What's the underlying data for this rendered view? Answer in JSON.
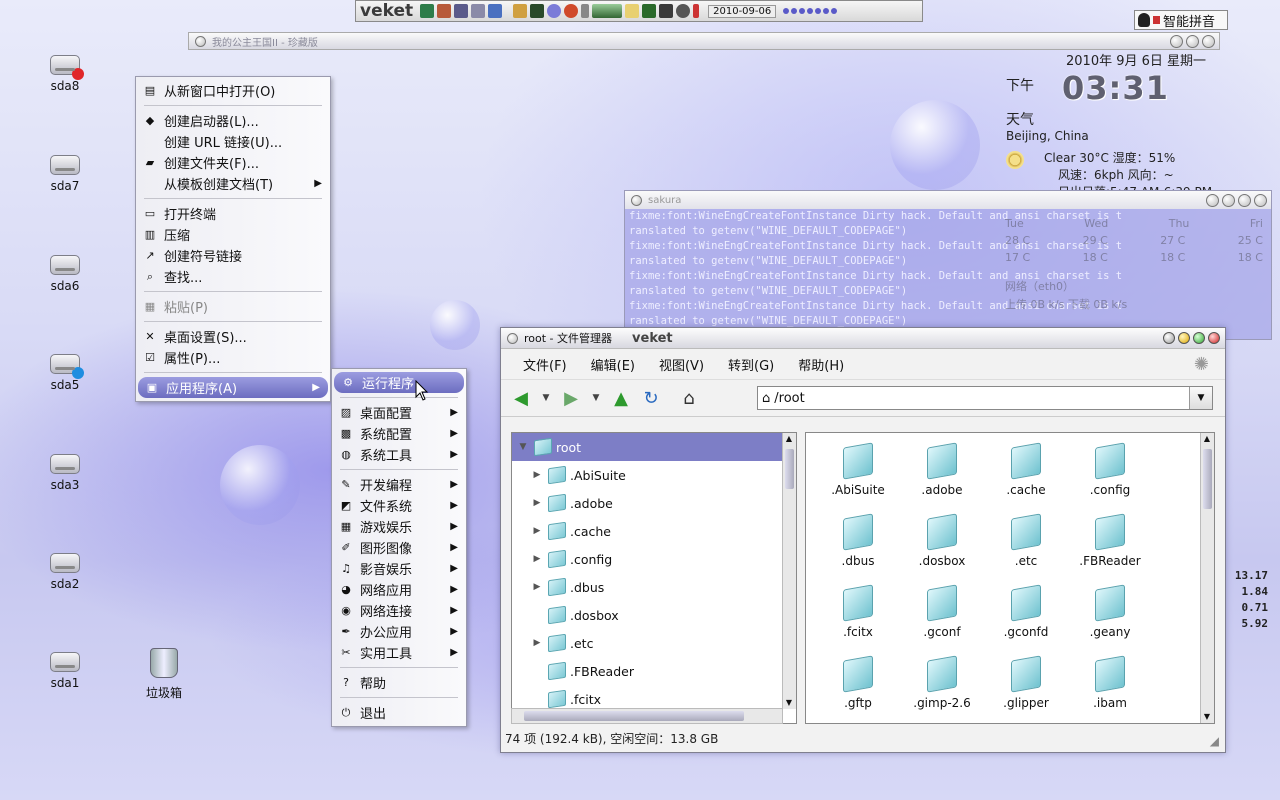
{
  "top_panel": {
    "logo": "veket",
    "date": "2010-09-06"
  },
  "ime": {
    "label": "智能拼音"
  },
  "bg_window": {
    "title": "我的公主王国II - 珍藏版"
  },
  "desktop_icons": [
    {
      "label": "sda8",
      "badge": "#e0262a"
    },
    {
      "label": "sda7",
      "badge": ""
    },
    {
      "label": "sda6",
      "badge": ""
    },
    {
      "label": "sda5",
      "badge": "#1e8de0"
    },
    {
      "label": "sda3",
      "badge": ""
    },
    {
      "label": "sda2",
      "badge": ""
    },
    {
      "label": "sda1",
      "badge": ""
    }
  ],
  "trash": {
    "label": "垃圾箱"
  },
  "widget": {
    "date": "2010年 9月 6日 星期一",
    "ampm": "下午",
    "time": "03:31",
    "weather_title": "天气",
    "location": "Beijing, China",
    "condition": "Clear  30°C 湿度：51%",
    "wind": "风速：6kph 风向：~",
    "sun": "日出日落:5:47 AM-6:39 PM",
    "forecast_days": [
      "Tue",
      "Wed",
      "Thu",
      "Fri"
    ],
    "forecast_highs": [
      "28 C",
      "29 C",
      "27 C",
      "25 C"
    ],
    "forecast_lows": [
      "17 C",
      "18 C",
      "18 C",
      "18 C"
    ],
    "net": "网络（eth0）",
    "net_rate": "上传 0B  k/s  下载 0B  k/s",
    "loads": [
      "13.17",
      "1.84",
      "0.71",
      "5.92"
    ]
  },
  "sakura": {
    "title": "sakura",
    "lines": [
      "fixme:font:WineEngCreateFontInstance Dirty hack. Default and ansi charset is t",
      "ranslated to getenv(\"WINE_DEFAULT_CODEPAGE\")",
      "fixme:font:WineEngCreateFontInstance Dirty hack. Default and ansi charset is t",
      "ranslated to getenv(\"WINE_DEFAULT_CODEPAGE\")",
      "fixme:font:WineEngCreateFontInstance Dirty hack. Default and ansi charset is t",
      "ranslated to getenv(\"WINE_DEFAULT_CODEPAGE\")",
      "fixme:font:WineEngCreateFontInstance Dirty hack. Default and ansi charset is t",
      "ranslated to getenv(\"WINE_DEFAULT_CODEPAGE\")"
    ]
  },
  "file_manager": {
    "title": "root - 文件管理器",
    "brand": "veket",
    "menu": [
      "文件(F)",
      "编辑(E)",
      "视图(V)",
      "转到(G)",
      "帮助(H)"
    ],
    "address": "/root",
    "tree": [
      {
        "label": "root",
        "expander": "▼",
        "selected": true
      },
      {
        "label": ".AbiSuite",
        "expander": "▶"
      },
      {
        "label": ".adobe",
        "expander": "▶"
      },
      {
        "label": ".cache",
        "expander": "▶"
      },
      {
        "label": ".config",
        "expander": "▶"
      },
      {
        "label": ".dbus",
        "expander": "▶"
      },
      {
        "label": ".dosbox",
        "expander": ""
      },
      {
        "label": ".etc",
        "expander": "▶"
      },
      {
        "label": ".FBReader",
        "expander": ""
      },
      {
        "label": ".fcitx",
        "expander": ""
      }
    ],
    "files": [
      ".AbiSuite",
      ".adobe",
      ".cache",
      ".config",
      ".dbus",
      ".dosbox",
      ".etc",
      ".FBReader",
      ".fcitx",
      ".gconf",
      ".gconfd",
      ".geany",
      ".gftp",
      ".gimp-2.6",
      ".glipper",
      ".ibam"
    ],
    "status": "74 项 (192.4 kB), 空闲空间：13.8 GB"
  },
  "desktop_menu": {
    "items": [
      {
        "label": "从新窗口中打开(O)",
        "icon": "folder-open-icon",
        "glyph": "▤"
      },
      {
        "sep": true
      },
      {
        "label": "创建启动器(L)...",
        "icon": "launcher-icon",
        "glyph": "◆"
      },
      {
        "label": "创建 URL 链接(U)...",
        "icon": "",
        "glyph": ""
      },
      {
        "label": "创建文件夹(F)...",
        "icon": "new-folder-icon",
        "glyph": "▰"
      },
      {
        "label": "从模板创建文档(T)",
        "icon": "",
        "glyph": "",
        "submenu": true
      },
      {
        "sep": true
      },
      {
        "label": "打开终端",
        "icon": "terminal-icon",
        "glyph": "▭"
      },
      {
        "label": "压缩",
        "icon": "compress-icon",
        "glyph": "▥"
      },
      {
        "label": "创建符号链接",
        "icon": "symlink-icon",
        "glyph": "↗"
      },
      {
        "label": "查找...",
        "icon": "find-icon",
        "glyph": "⌕"
      },
      {
        "sep": true
      },
      {
        "label": "粘贴(P)",
        "icon": "paste-icon",
        "glyph": "▦",
        "disabled": true
      },
      {
        "sep": true
      },
      {
        "label": "桌面设置(S)...",
        "icon": "desktop-settings-icon",
        "glyph": "✕"
      },
      {
        "label": "属性(P)...",
        "icon": "properties-icon",
        "glyph": "☑"
      },
      {
        "sep": true
      },
      {
        "label": "应用程序(A)",
        "icon": "applications-icon",
        "glyph": "▣",
        "submenu": true,
        "highlighted": true
      }
    ]
  },
  "apps_menu": {
    "items": [
      {
        "label": "运行程序",
        "icon": "run-program-icon",
        "glyph": "⚙",
        "highlighted": true
      },
      {
        "sep": true
      },
      {
        "label": "桌面配置",
        "icon": "desktop-config-icon",
        "glyph": "▨",
        "submenu": true
      },
      {
        "label": "系统配置",
        "icon": "system-config-icon",
        "glyph": "▩",
        "submenu": true
      },
      {
        "label": "系统工具",
        "icon": "system-tools-icon",
        "glyph": "◍",
        "submenu": true
      },
      {
        "sep": true
      },
      {
        "label": "开发编程",
        "icon": "dev-icon",
        "glyph": "✎",
        "submenu": true
      },
      {
        "label": "文件系统",
        "icon": "filesystem-icon",
        "glyph": "◩",
        "submenu": true
      },
      {
        "label": "游戏娱乐",
        "icon": "games-icon",
        "glyph": "▦",
        "submenu": true
      },
      {
        "label": "图形图像",
        "icon": "graphics-icon",
        "glyph": "✐",
        "submenu": true
      },
      {
        "label": "影音娱乐",
        "icon": "multimedia-icon",
        "glyph": "♫",
        "submenu": true
      },
      {
        "label": "网络应用",
        "icon": "internet-icon",
        "glyph": "◕",
        "submenu": true
      },
      {
        "label": "网络连接",
        "icon": "network-icon",
        "glyph": "◉",
        "submenu": true
      },
      {
        "label": "办公应用",
        "icon": "office-icon",
        "glyph": "✒",
        "submenu": true
      },
      {
        "label": "实用工具",
        "icon": "utilities-icon",
        "glyph": "✂",
        "submenu": true
      },
      {
        "sep": true
      },
      {
        "label": "帮助",
        "icon": "help-icon",
        "glyph": "?"
      },
      {
        "sep": true
      },
      {
        "label": "退出",
        "icon": "exit-icon",
        "glyph": "⏻"
      }
    ]
  }
}
